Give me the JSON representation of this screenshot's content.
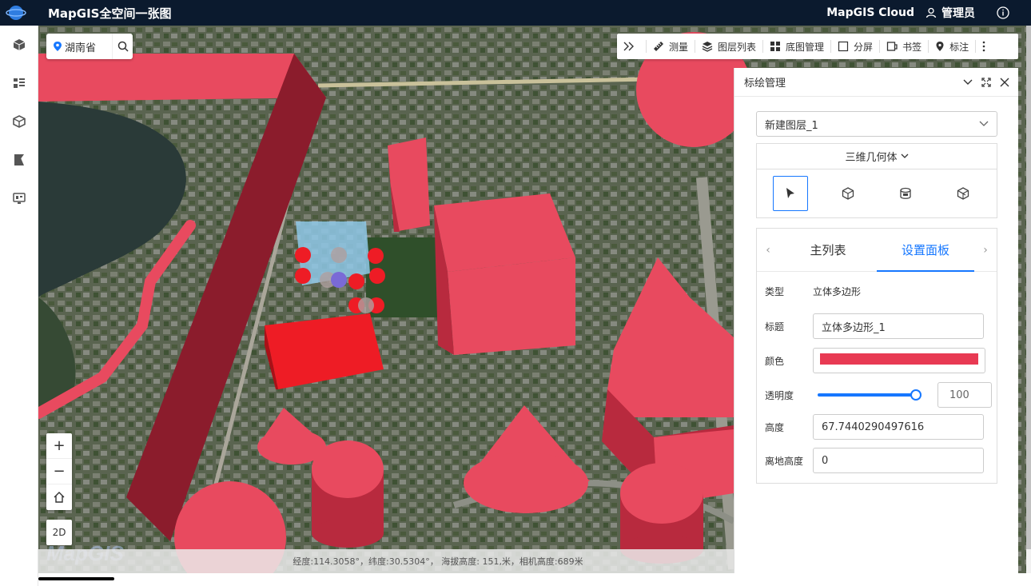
{
  "header": {
    "title": "MapGIS全空间一张图",
    "brand": "MapGIS Cloud",
    "user": "管理员",
    "icons": [
      "globe-logo-icon",
      "user-icon",
      "info-icon"
    ]
  },
  "sidebar": {
    "items": [
      {
        "icon": "cube-icon"
      },
      {
        "icon": "layer-list-icon"
      },
      {
        "icon": "model-icon"
      },
      {
        "icon": "analysis-icon"
      },
      {
        "icon": "screen-icon"
      }
    ]
  },
  "map": {
    "search_region": "湖南省",
    "toolbar": [
      {
        "label": "",
        "icon": "expand-icon"
      },
      {
        "label": "测量",
        "icon": "ruler-icon"
      },
      {
        "label": "图层列表",
        "icon": "layers-icon"
      },
      {
        "label": "底图管理",
        "icon": "grid-icon"
      },
      {
        "label": "分屏",
        "icon": "split-icon"
      },
      {
        "label": "书签",
        "icon": "bookmark-icon"
      },
      {
        "label": "标注",
        "icon": "pin-icon"
      }
    ],
    "zoom_in": "+",
    "zoom_out": "−",
    "mode_2d": "2D",
    "watermark": "MapGIS",
    "status": "经度:114.3058°，纬度:30.5304°， 海拔高度: 151,米，相机高度:689米"
  },
  "panel": {
    "title": "标绘管理",
    "layer": "新建图层_1",
    "geometry_type": "三维几何体",
    "tabs": [
      "主列表",
      "设置面板"
    ],
    "active_tab": 1,
    "fields": {
      "type_label": "类型",
      "type_value": "立体多边形",
      "title_label": "标题",
      "title_value": "立体多边形_1",
      "color_label": "颜色",
      "color_value": "#e83a53",
      "opacity_label": "透明度",
      "opacity_value": "100",
      "height_label": "高度",
      "height_value": "67.7440290497616",
      "ground_label": "离地高度",
      "ground_value": "0"
    }
  },
  "colors": {
    "header_bg": "#0b1a2e",
    "accent": "#1677ff",
    "geometry_red": "#e83a53"
  }
}
